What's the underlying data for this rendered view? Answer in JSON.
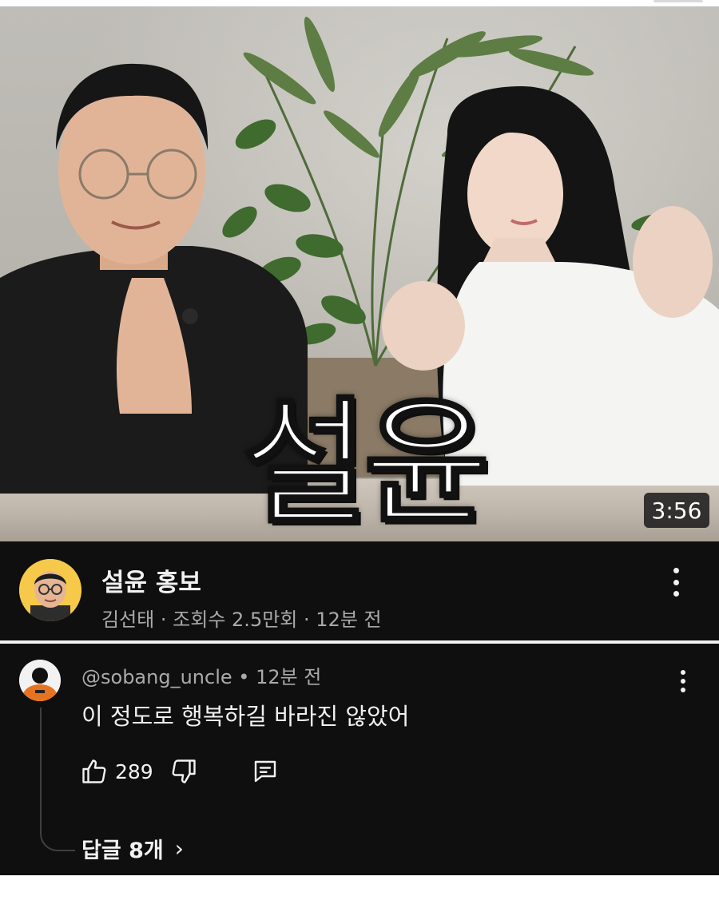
{
  "video": {
    "thumbnail_overlay_text": "설윤",
    "duration": "3:56",
    "title": "설윤 홍보",
    "channel": "김선태",
    "views": "조회수 2.5만회",
    "age": "12분 전",
    "meta_separator": "·"
  },
  "comment": {
    "author": "@sobang_uncle",
    "separator": "•",
    "age": "12분 전",
    "text": "이 정도로 행복하길 바라진 않았어",
    "likes": "289",
    "replies_label": "답글 8개",
    "replies_chevron": "›"
  },
  "icons": {
    "video_more": "more-vert-icon",
    "comment_more": "more-vert-icon",
    "like": "thumb-up-icon",
    "dislike": "thumb-down-icon",
    "reply": "comment-icon"
  },
  "colors": {
    "background_dark": "#0f0f0f",
    "text_primary": "#f1f1f1",
    "text_secondary": "#aaaaaa",
    "duration_badge": "#141414"
  }
}
